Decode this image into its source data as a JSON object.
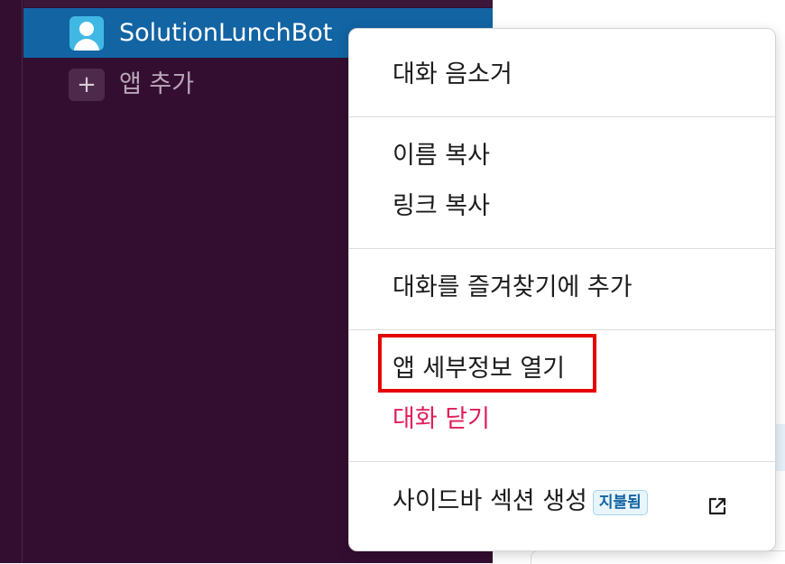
{
  "sidebar": {
    "dm_name": "SolutionLunchBot",
    "add_app_label": "앱 추가",
    "add_app_icon": "plus-icon"
  },
  "context_menu": {
    "mute": "대화 음소거",
    "copy_name": "이름 복사",
    "copy_link": "링크 복사",
    "add_favorite": "대화를 즐겨찾기에 추가",
    "open_app_details": "앱 세부정보 열기",
    "close_conversation": "대화 닫기",
    "create_section": "사이드바 섹션 생성",
    "create_section_badge": "지불됨",
    "create_section_icon": "external-link-icon"
  },
  "colors": {
    "sidebar_bg": "#330e31",
    "selected_row": "#1264a3",
    "danger": "#e01e5a",
    "highlight": "#e60000"
  }
}
